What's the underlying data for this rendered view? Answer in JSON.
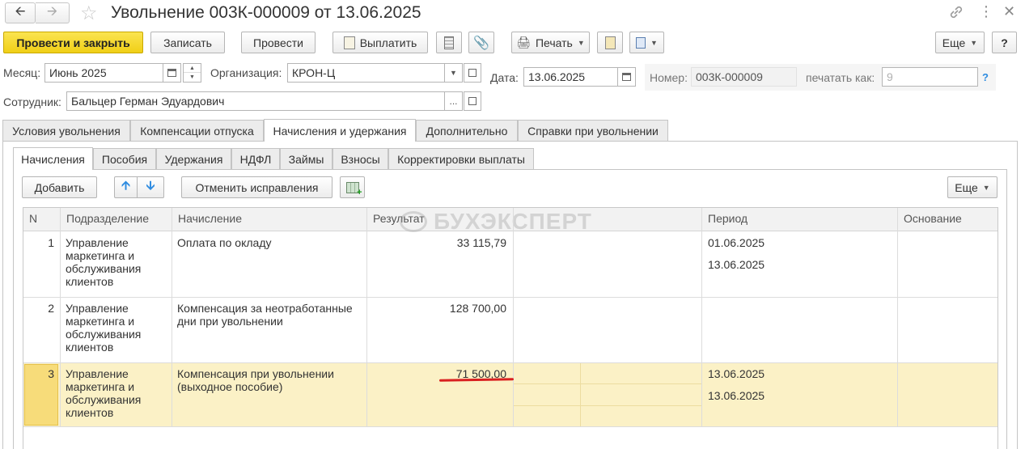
{
  "window": {
    "title": "Увольнение 003К-000009 от 13.06.2025"
  },
  "toolbar": {
    "post_close": "Провести и закрыть",
    "save": "Записать",
    "post": "Провести",
    "pay": "Выплатить",
    "print": "Печать",
    "more": "Еще",
    "help": "?"
  },
  "header": {
    "month_label": "Месяц:",
    "month_value": "Июнь 2025",
    "org_label": "Организация:",
    "org_value": "КРОН-Ц",
    "date_label": "Дата:",
    "date_value": "13.06.2025",
    "number_label": "Номер:",
    "number_value": "003К-000009",
    "print_as_label": "печатать как:",
    "print_as_value": "9",
    "employee_label": "Сотрудник:",
    "employee_value": "Бальцер Герман Эдуардович",
    "help_q": "?"
  },
  "tabs": [
    "Условия увольнения",
    "Компенсации отпуска",
    "Начисления и удержания",
    "Дополнительно",
    "Справки при увольнении"
  ],
  "subtabs": [
    "Начисления",
    "Пособия",
    "Удержания",
    "НДФЛ",
    "Займы",
    "Взносы",
    "Корректировки выплаты"
  ],
  "table_toolbar": {
    "add": "Добавить",
    "cancel_corrections": "Отменить исправления",
    "more": "Еще"
  },
  "watermark": "БУХЭКСПЕРТ",
  "columns": [
    "N",
    "Подразделение",
    "Начисление",
    "Результат",
    "Период",
    "Основание"
  ],
  "rows": [
    {
      "n": "1",
      "division": [
        "Управление",
        "маркетинга и",
        "обслуживания",
        "клиентов"
      ],
      "accrual": [
        "Оплата по окладу"
      ],
      "result": "33 115,79",
      "period_start": "01.06.2025",
      "period_end": "13.06.2025",
      "basis": ""
    },
    {
      "n": "2",
      "division": [
        "Управление",
        "маркетинга и",
        "обслуживания",
        "клиентов"
      ],
      "accrual": [
        "Компенсация за неотработанные",
        "дни при увольнении"
      ],
      "result": "128 700,00",
      "period_start": "",
      "period_end": "",
      "basis": ""
    },
    {
      "n": "3",
      "division": [
        "Управление",
        "маркетинга и",
        "обслуживания",
        "клиентов"
      ],
      "accrual": [
        "Компенсация при увольнении",
        "(выходное пособие)"
      ],
      "result": "71 500,00",
      "period_start": "13.06.2025",
      "period_end": "13.06.2025",
      "basis": ""
    }
  ],
  "colors": {
    "primary_button": "#f0cf16",
    "selected_row": "#fbf1c6",
    "selected_cell": "#f7dc7a",
    "underline": "#d92020",
    "arrow_blue": "#2d8be0"
  }
}
